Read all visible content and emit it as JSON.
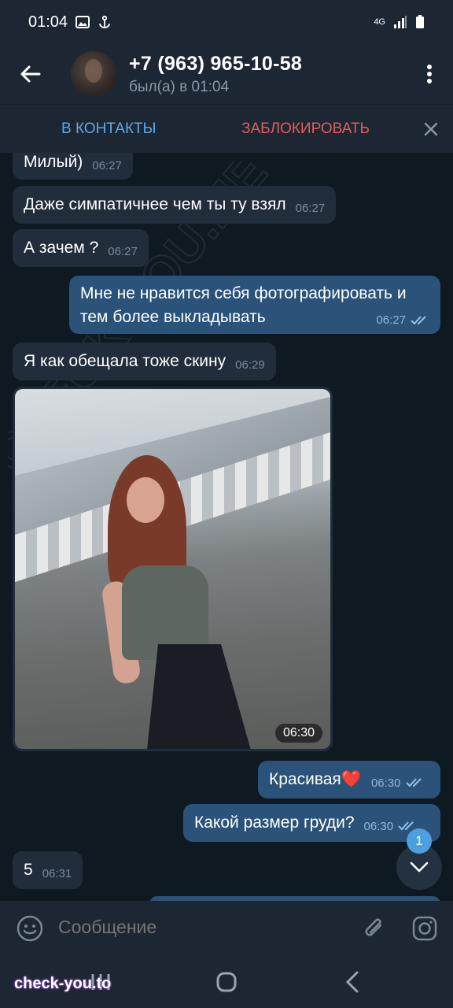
{
  "status_bar": {
    "time": "01:04",
    "network": "4G"
  },
  "header": {
    "title": "+7 (963) 965-10-58",
    "subtitle": "был(а) в 01:04"
  },
  "action_bar": {
    "add_contact": "В КОНТАКТЫ",
    "block": "ЗАБЛОКИРОВАТЬ"
  },
  "messages": [
    {
      "dir": "in",
      "text": "Милый)",
      "time": "06:27"
    },
    {
      "dir": "in",
      "text": "Даже симпатичнее чем ты ту взял",
      "time": "06:27"
    },
    {
      "dir": "in",
      "text": "А зачем ?",
      "time": "06:27"
    },
    {
      "dir": "out",
      "text": "Мне не нравится себя фотографировать и",
      "text2": "тем более выкладывать",
      "time": "06:27"
    },
    {
      "dir": "in",
      "text": "Я как обещала тоже скину",
      "time": "06:29"
    },
    {
      "dir": "in",
      "type": "photo",
      "time": "06:30"
    },
    {
      "dir": "out",
      "text": "Красивая❤️",
      "time": "06:30"
    },
    {
      "dir": "out",
      "text": "Какой размер груди?",
      "time": "06:30"
    },
    {
      "dir": "in",
      "text": "5",
      "time": "06:31"
    }
  ],
  "scroll_badge": "1",
  "input": {
    "placeholder": "Сообщение"
  },
  "watermark": {
    "bottom": "check-you.to",
    "diagonal": "CHECK-YOU.ME"
  },
  "colors": {
    "background": "#0f1921",
    "panel": "#1d2733",
    "incoming_bubble": "#212d3b",
    "outgoing_bubble": "#2b5278",
    "accent": "#5fa8e6",
    "danger": "#e25c5c"
  }
}
